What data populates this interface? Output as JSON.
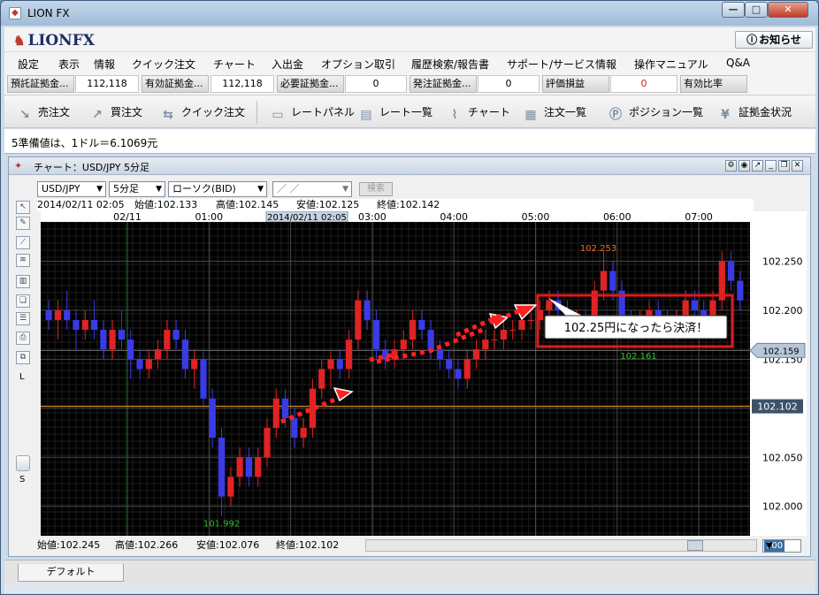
{
  "window": {
    "title": "LION FX"
  },
  "logo": {
    "text": "LIONFX"
  },
  "notice_button": {
    "label": "お知らせ"
  },
  "menu": [
    "設定",
    "表示",
    "情報",
    "クイック注文",
    "チャート",
    "入出金",
    "オプション取引",
    "履歴検索/報告書",
    "サポート/サービス情報",
    "操作マニュアル",
    "Q&A"
  ],
  "info_bar": [
    {
      "label": "預託証拠金...",
      "value": "112,118"
    },
    {
      "label": "有効証拠金...",
      "value": "112,118"
    },
    {
      "label": "必要証拠金...",
      "value": "0"
    },
    {
      "label": "発注証拠金...",
      "value": "0"
    },
    {
      "label": "評価損益",
      "value": "0"
    },
    {
      "label": "有効比率",
      "value": ""
    }
  ],
  "toolbar": [
    "売注文",
    "買注文",
    "クイック注文",
    "レートパネル",
    "レート一覧",
    "チャート",
    "注文一覧",
    "ポジション一覧",
    "証拠金状況"
  ],
  "ticker": "5準備値は、1ドル＝6.1069元",
  "chart_window": {
    "title": "チャート：USD/JPY 5分足"
  },
  "controls": {
    "pair": "USD/JPY",
    "timeframe": "5分足",
    "candle_type": "ローソク(BID)",
    "date": "／ ／",
    "search": "検索"
  },
  "header_ohlc": {
    "time": "2014/02/11 02:05",
    "open": "始値:102.133",
    "high": "高値:102.145",
    "low": "安値:102.125",
    "close": "終値:102.142"
  },
  "footer_ohlc": {
    "open": "始値:102.245",
    "high": "高値:102.266",
    "low": "安値:102.076",
    "close": "終値:102.102"
  },
  "zoom": "100",
  "tab": "デフォルト",
  "colors": {
    "up": "#e02323",
    "down": "#3a3ae6",
    "hline_bid": "#d88a2b",
    "bg": "#000000",
    "annotation": "#e01a1a"
  },
  "left_tools_lower": "L",
  "left_tools_upper": "S",
  "chart_data": {
    "type": "candlestick",
    "x_tick_labels": [
      "02/11",
      "01:00",
      "02:00",
      "03:00",
      "04:00",
      "05:00",
      "06:00",
      "07:00"
    ],
    "cursor_label": "2014/02/11 02:05",
    "y_ticks": [
      102.25,
      102.2,
      102.15,
      102.1,
      102.05,
      102.0
    ],
    "y_tick_labels": [
      "102.250",
      "102.200",
      "102.150",
      "102.100",
      "102.050",
      "102.000"
    ],
    "ylim": [
      101.97,
      102.29
    ],
    "current_price_label": "102.159",
    "current_price": 102.159,
    "bid_line_label": "102.102",
    "bid_line": 102.102,
    "high_marker": {
      "label": "102.253",
      "value": 102.253
    },
    "low_marker": {
      "label": "101.992",
      "value": 101.992
    },
    "local_low_marker": {
      "label": "102.161",
      "value": 102.161
    },
    "annotation": "102.25円になったら決済！",
    "candles": [
      [
        102.2,
        102.21,
        102.18,
        102.19
      ],
      [
        102.19,
        102.21,
        102.17,
        102.2
      ],
      [
        102.2,
        102.22,
        102.18,
        102.19
      ],
      [
        102.19,
        102.2,
        102.16,
        102.18
      ],
      [
        102.18,
        102.2,
        102.17,
        102.19
      ],
      [
        102.19,
        102.21,
        102.17,
        102.18
      ],
      [
        102.18,
        102.19,
        102.15,
        102.16
      ],
      [
        102.16,
        102.19,
        102.15,
        102.18
      ],
      [
        102.18,
        102.2,
        102.16,
        102.17
      ],
      [
        102.17,
        102.18,
        102.13,
        102.15
      ],
      [
        102.15,
        102.16,
        102.13,
        102.14
      ],
      [
        102.14,
        102.16,
        102.13,
        102.15
      ],
      [
        102.15,
        102.17,
        102.14,
        102.16
      ],
      [
        102.16,
        102.19,
        102.15,
        102.18
      ],
      [
        102.18,
        102.19,
        102.16,
        102.17
      ],
      [
        102.17,
        102.18,
        102.13,
        102.14
      ],
      [
        102.14,
        102.16,
        102.12,
        102.15
      ],
      [
        102.15,
        102.16,
        102.1,
        102.11
      ],
      [
        102.11,
        102.12,
        102.06,
        102.07
      ],
      [
        102.07,
        102.08,
        101.99,
        102.01
      ],
      [
        102.01,
        102.04,
        102.0,
        102.03
      ],
      [
        102.03,
        102.06,
        102.02,
        102.05
      ],
      [
        102.05,
        102.06,
        102.02,
        102.03
      ],
      [
        102.03,
        102.06,
        102.02,
        102.05
      ],
      [
        102.05,
        102.09,
        102.04,
        102.08
      ],
      [
        102.08,
        102.12,
        102.07,
        102.11
      ],
      [
        102.11,
        102.12,
        102.08,
        102.09
      ],
      [
        102.09,
        102.1,
        102.06,
        102.07
      ],
      [
        102.07,
        102.09,
        102.06,
        102.08
      ],
      [
        102.08,
        102.13,
        102.07,
        102.12
      ],
      [
        102.12,
        102.15,
        102.11,
        102.14
      ],
      [
        102.14,
        102.16,
        102.12,
        102.15
      ],
      [
        102.15,
        102.16,
        102.13,
        102.14
      ],
      [
        102.14,
        102.18,
        102.13,
        102.17
      ],
      [
        102.17,
        102.22,
        102.16,
        102.21
      ],
      [
        102.21,
        102.22,
        102.18,
        102.19
      ],
      [
        102.19,
        102.2,
        102.15,
        102.16
      ],
      [
        102.16,
        102.17,
        102.14,
        102.15
      ],
      [
        102.15,
        102.17,
        102.14,
        102.16
      ],
      [
        102.16,
        102.18,
        102.15,
        102.17
      ],
      [
        102.17,
        102.2,
        102.16,
        102.19
      ],
      [
        102.19,
        102.2,
        102.17,
        102.18
      ],
      [
        102.18,
        102.19,
        102.15,
        102.16
      ],
      [
        102.16,
        102.17,
        102.14,
        102.15
      ],
      [
        102.15,
        102.16,
        102.13,
        102.14
      ],
      [
        102.14,
        102.15,
        102.12,
        102.13
      ],
      [
        102.13,
        102.16,
        102.12,
        102.15
      ],
      [
        102.15,
        102.17,
        102.14,
        102.16
      ],
      [
        102.16,
        102.18,
        102.15,
        102.17
      ],
      [
        102.17,
        102.18,
        102.16,
        102.17
      ],
      [
        102.17,
        102.19,
        102.16,
        102.18
      ],
      [
        102.18,
        102.19,
        102.17,
        102.18
      ],
      [
        102.18,
        102.2,
        102.17,
        102.19
      ],
      [
        102.19,
        102.2,
        102.18,
        102.19
      ],
      [
        102.19,
        102.21,
        102.18,
        102.2
      ],
      [
        102.2,
        102.22,
        102.19,
        102.21
      ],
      [
        102.21,
        102.22,
        102.19,
        102.2
      ],
      [
        102.2,
        102.21,
        102.18,
        102.19
      ],
      [
        102.19,
        102.2,
        102.18,
        102.19
      ],
      [
        102.19,
        102.2,
        102.17,
        102.18
      ],
      [
        102.18,
        102.23,
        102.18,
        102.22
      ],
      [
        102.22,
        102.26,
        102.21,
        102.24
      ],
      [
        102.24,
        102.25,
        102.21,
        102.22
      ],
      [
        102.22,
        102.23,
        102.18,
        102.19
      ],
      [
        102.19,
        102.2,
        102.17,
        102.18
      ],
      [
        102.18,
        102.2,
        102.17,
        102.19
      ],
      [
        102.19,
        102.21,
        102.18,
        102.2
      ],
      [
        102.2,
        102.21,
        102.18,
        102.19
      ],
      [
        102.19,
        102.2,
        102.17,
        102.18
      ],
      [
        102.18,
        102.2,
        102.17,
        102.19
      ],
      [
        102.19,
        102.22,
        102.18,
        102.21
      ],
      [
        102.21,
        102.22,
        102.19,
        102.2
      ],
      [
        102.2,
        102.21,
        102.18,
        102.19
      ],
      [
        102.19,
        102.22,
        102.18,
        102.21
      ],
      [
        102.21,
        102.26,
        102.2,
        102.25
      ],
      [
        102.25,
        102.26,
        102.22,
        102.23
      ],
      [
        102.23,
        102.24,
        102.2,
        102.21
      ]
    ]
  }
}
